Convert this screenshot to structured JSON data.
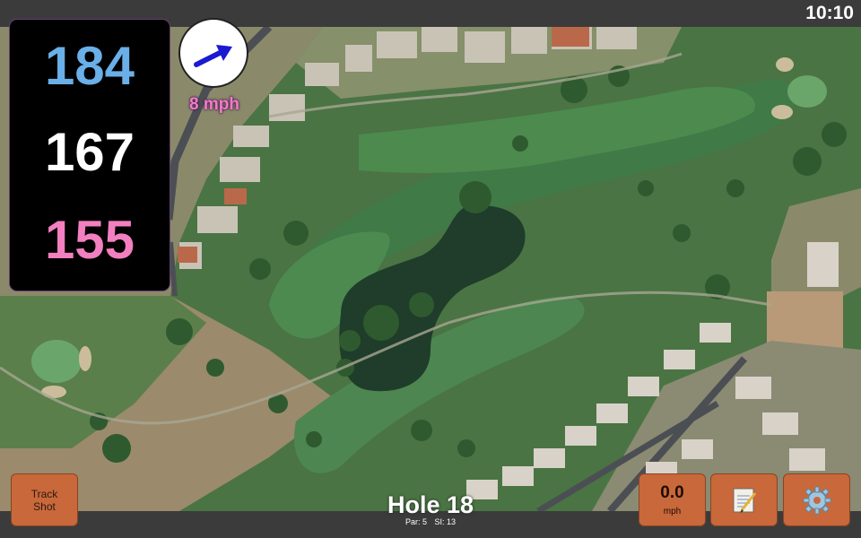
{
  "status": {
    "time": "10:10"
  },
  "distances": {
    "back": "184",
    "middle": "167",
    "front": "155"
  },
  "wind": {
    "speed_label": "8 mph",
    "value": "0.0",
    "unit": "mph",
    "arrow_icon": "wind-direction-arrow-icon"
  },
  "buttons": {
    "track_shot_line1": "Track",
    "track_shot_line2": "Shot",
    "notes_icon": "notepad-icon",
    "settings_icon": "gear-icon"
  },
  "hole": {
    "title": "Hole 18",
    "par": "Par: 5",
    "si": "SI: 13"
  },
  "colors": {
    "back": "#6aafe8",
    "middle": "#ffffff",
    "front": "#f27fc0",
    "button": "#c9683a"
  }
}
